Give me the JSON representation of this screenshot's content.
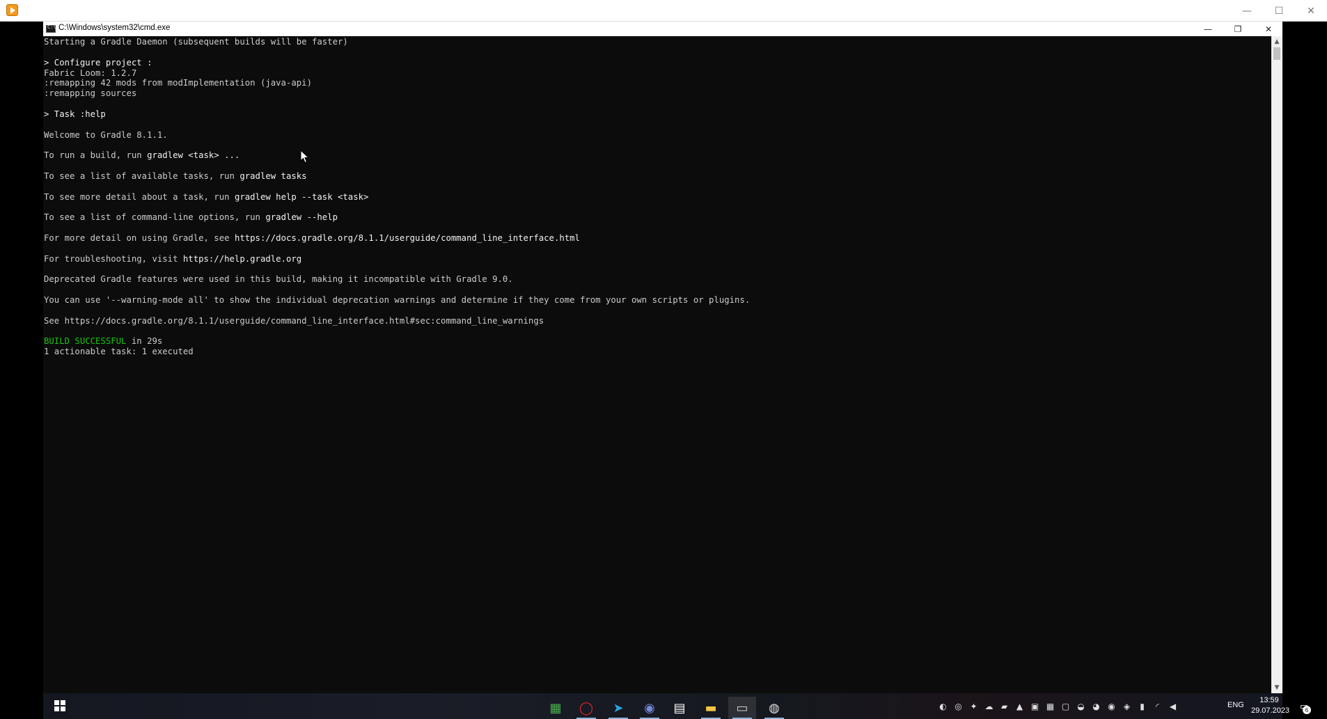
{
  "outer_window": {
    "app_icon": "video-player-icon",
    "minimize_glyph": "—",
    "maximize_glyph": "☐",
    "close_glyph": "✕"
  },
  "cmd_window": {
    "title": "C:\\Windows\\system32\\cmd.exe",
    "icon": "cmd-icon",
    "minimize_glyph": "—",
    "restore_glyph": "❐",
    "close_glyph": "✕"
  },
  "console": {
    "lines": [
      {
        "segments": [
          {
            "text": "Starting a Gradle Daemon (subsequent builds will be faster)",
            "style": "normal"
          }
        ]
      },
      {
        "segments": [
          {
            "text": "",
            "style": "normal"
          }
        ]
      },
      {
        "segments": [
          {
            "text": "> Configure project :",
            "style": "bright"
          }
        ]
      },
      {
        "segments": [
          {
            "text": "Fabric Loom: 1.2.7",
            "style": "normal"
          }
        ]
      },
      {
        "segments": [
          {
            "text": ":remapping 42 mods from modImplementation (java-api)",
            "style": "normal"
          }
        ]
      },
      {
        "segments": [
          {
            "text": ":remapping sources",
            "style": "normal"
          }
        ]
      },
      {
        "segments": [
          {
            "text": "",
            "style": "normal"
          }
        ]
      },
      {
        "segments": [
          {
            "text": "> Task :help",
            "style": "bright"
          }
        ]
      },
      {
        "segments": [
          {
            "text": "",
            "style": "normal"
          }
        ]
      },
      {
        "segments": [
          {
            "text": "Welcome to Gradle 8.1.1.",
            "style": "normal"
          }
        ]
      },
      {
        "segments": [
          {
            "text": "",
            "style": "normal"
          }
        ]
      },
      {
        "segments": [
          {
            "text": "To run a build, run ",
            "style": "normal"
          },
          {
            "text": "gradlew <task> ...",
            "style": "bright"
          }
        ]
      },
      {
        "segments": [
          {
            "text": "",
            "style": "normal"
          }
        ]
      },
      {
        "segments": [
          {
            "text": "To see a list of available tasks, run ",
            "style": "normal"
          },
          {
            "text": "gradlew tasks",
            "style": "bright"
          }
        ]
      },
      {
        "segments": [
          {
            "text": "",
            "style": "normal"
          }
        ]
      },
      {
        "segments": [
          {
            "text": "To see more detail about a task, run ",
            "style": "normal"
          },
          {
            "text": "gradlew help --task <task>",
            "style": "bright"
          }
        ]
      },
      {
        "segments": [
          {
            "text": "",
            "style": "normal"
          }
        ]
      },
      {
        "segments": [
          {
            "text": "To see a list of command-line options, run ",
            "style": "normal"
          },
          {
            "text": "gradlew --help",
            "style": "bright"
          }
        ]
      },
      {
        "segments": [
          {
            "text": "",
            "style": "normal"
          }
        ]
      },
      {
        "segments": [
          {
            "text": "For more detail on using Gradle, see ",
            "style": "normal"
          },
          {
            "text": "https://docs.gradle.org/8.1.1/userguide/command_line_interface.html",
            "style": "bright"
          }
        ]
      },
      {
        "segments": [
          {
            "text": "",
            "style": "normal"
          }
        ]
      },
      {
        "segments": [
          {
            "text": "For troubleshooting, visit ",
            "style": "normal"
          },
          {
            "text": "https://help.gradle.org",
            "style": "bright"
          }
        ]
      },
      {
        "segments": [
          {
            "text": "",
            "style": "normal"
          }
        ]
      },
      {
        "segments": [
          {
            "text": "Deprecated Gradle features were used in this build, making it incompatible with Gradle 9.0.",
            "style": "normal"
          }
        ]
      },
      {
        "segments": [
          {
            "text": "",
            "style": "normal"
          }
        ]
      },
      {
        "segments": [
          {
            "text": "You can use '--warning-mode all' to show the individual deprecation warnings and determine if they come from your own scripts or plugins.",
            "style": "normal"
          }
        ]
      },
      {
        "segments": [
          {
            "text": "",
            "style": "normal"
          }
        ]
      },
      {
        "segments": [
          {
            "text": "See https://docs.gradle.org/8.1.1/userguide/command_line_interface.html#sec:command_line_warnings",
            "style": "normal"
          }
        ]
      },
      {
        "segments": [
          {
            "text": "",
            "style": "normal"
          }
        ]
      },
      {
        "segments": [
          {
            "text": "BUILD SUCCESSFUL",
            "style": "success"
          },
          {
            "text": " in 29s",
            "style": "normal"
          }
        ]
      },
      {
        "segments": [
          {
            "text": "1 actionable task: 1 executed",
            "style": "normal"
          }
        ]
      }
    ]
  },
  "colors": {
    "console_bg": "#0c0c0c",
    "console_text": "#cccccc",
    "console_bright": "#f2f2f2",
    "success": "#16c60c"
  },
  "taskbar": {
    "start_icon": "windows-start-icon",
    "apps": [
      {
        "name": "taskbar-app-bluestacks",
        "glyph": "▦",
        "color": "#4caf50",
        "active": false
      },
      {
        "name": "taskbar-app-opera",
        "glyph": "◯",
        "color": "#e3262b",
        "active": false,
        "running": true
      },
      {
        "name": "taskbar-app-telegram",
        "glyph": "➤",
        "color": "#2aa3e0",
        "active": false,
        "running": true
      },
      {
        "name": "taskbar-app-discord",
        "glyph": "◉",
        "color": "#7289da",
        "active": false,
        "running": true
      },
      {
        "name": "taskbar-app-notepad",
        "glyph": "▤",
        "color": "#ffffff",
        "active": false
      },
      {
        "name": "taskbar-app-file-explorer",
        "glyph": "▬",
        "color": "#f4c542",
        "active": false,
        "running": true
      },
      {
        "name": "taskbar-app-cmd",
        "glyph": "▭",
        "color": "#d0d0d0",
        "active": true,
        "running": true
      },
      {
        "name": "taskbar-app-obs",
        "glyph": "◍",
        "color": "#e0e0e0",
        "active": false,
        "running": true
      }
    ],
    "tray_icons": [
      {
        "name": "steam-icon",
        "glyph": "◐"
      },
      {
        "name": "browser-tray-icon",
        "glyph": "◎"
      },
      {
        "name": "game-tray-icon",
        "glyph": "✦"
      },
      {
        "name": "cloud-tray-icon",
        "glyph": "☁"
      },
      {
        "name": "nvidia-icon",
        "glyph": "▰"
      },
      {
        "name": "warning-tray-icon",
        "glyph": "▲"
      },
      {
        "name": "office-tray-icon",
        "glyph": "▣"
      },
      {
        "name": "bluestacks-tray-icon",
        "glyph": "▦"
      },
      {
        "name": "screen-tray-icon",
        "glyph": "▢"
      },
      {
        "name": "github-tray-icon",
        "glyph": "◒"
      },
      {
        "name": "chrome-tray-icon",
        "glyph": "◕"
      },
      {
        "name": "color-tray-icon",
        "glyph": "◉"
      },
      {
        "name": "shield-tray-icon",
        "glyph": "◈"
      },
      {
        "name": "microphone-icon",
        "glyph": "▮"
      },
      {
        "name": "wifi-icon",
        "glyph": "◜"
      },
      {
        "name": "volume-icon",
        "glyph": "◀"
      }
    ],
    "language": "ENG",
    "time": "13:59",
    "date": "29.07.2023",
    "notifications_count": "6",
    "notification_icon": "notification-center-icon"
  }
}
